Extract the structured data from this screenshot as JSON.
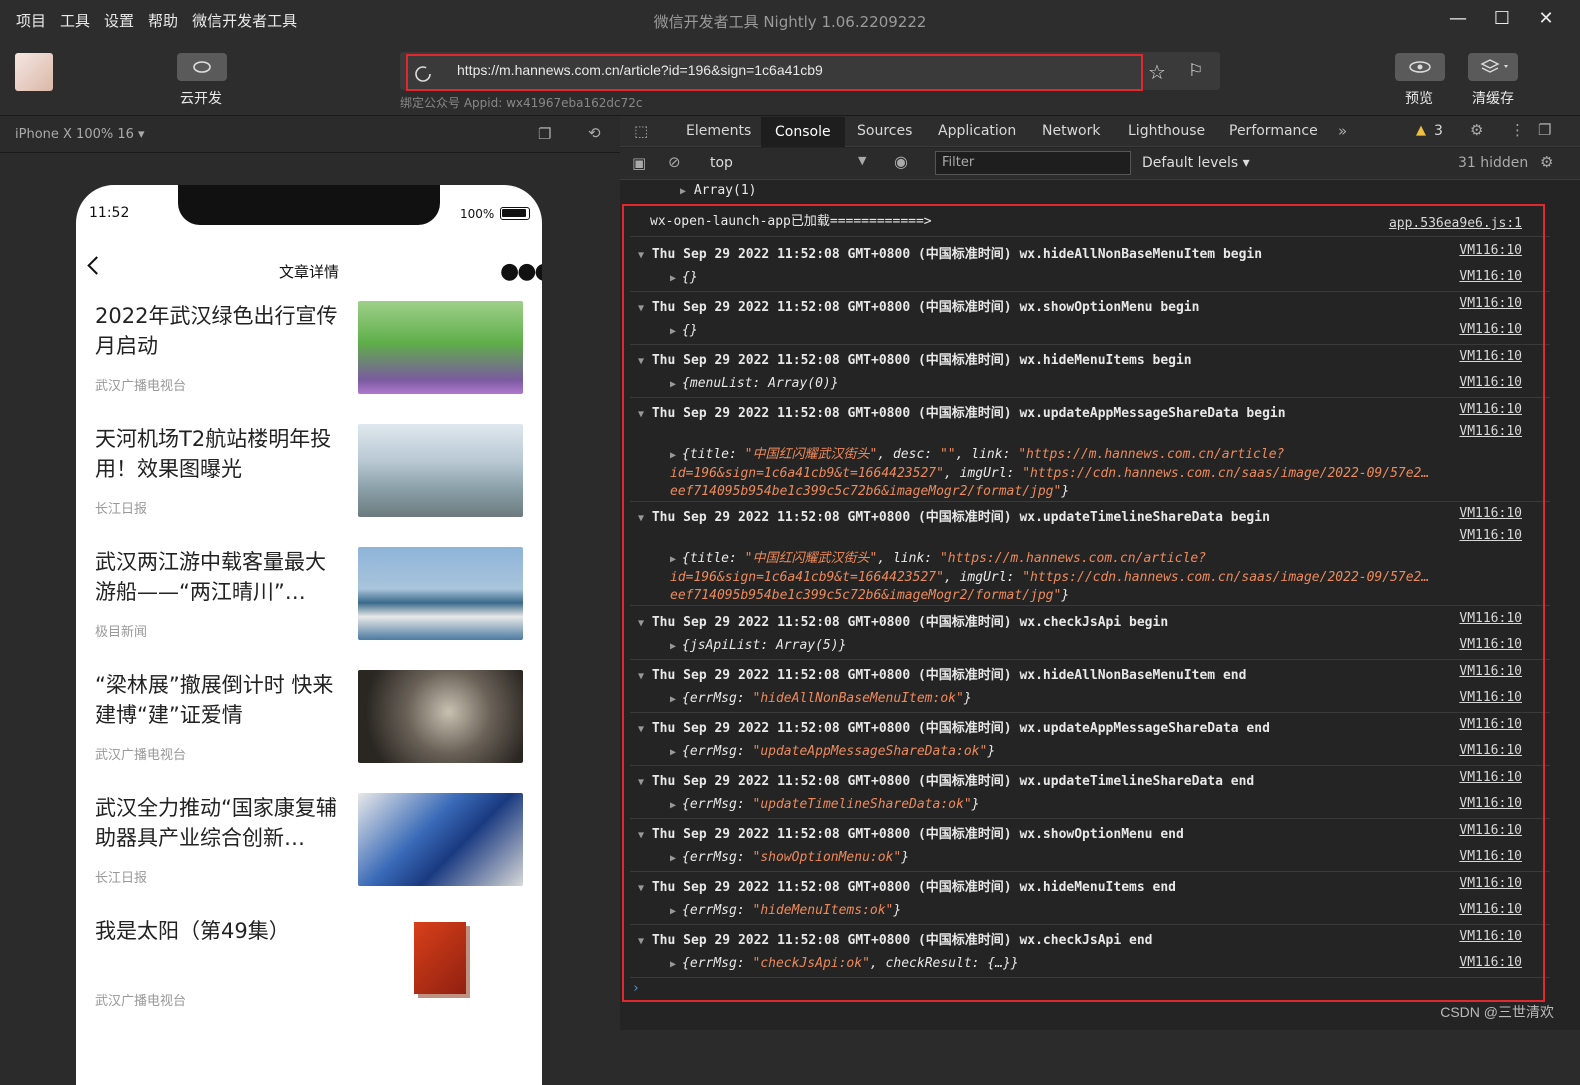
{
  "menu": [
    "项目",
    "工具",
    "设置",
    "帮助",
    "微信开发者工具"
  ],
  "window_title": "微信开发者工具 Nightly 1.06.2209222",
  "toolbar": {
    "cloud_label": "云开发",
    "url": "https://m.hannews.com.cn/article?id=196&sign=1c6a41cb9",
    "appid": "绑定公众号 Appid: wx41967eba162dc72c",
    "preview_label": "预览",
    "clearcache_label": "清缓存"
  },
  "device": "iPhone X 100% 16 ▾",
  "phone": {
    "time": "11:52",
    "battery": "100%",
    "nav_title": "文章详情",
    "news": [
      {
        "title": "2022年武汉绿色出行宣传月启动",
        "source": "武汉广播电视台"
      },
      {
        "title": "天河机场T2航站楼明年投用！效果图曝光",
        "source": "长江日报"
      },
      {
        "title": "武汉两江游中载客量最大游船——“两江晴川”…",
        "source": "极目新闻"
      },
      {
        "title": "“梁林展”撤展倒计时 快来建博“建”证爱情",
        "source": "武汉广播电视台"
      },
      {
        "title": "武汉全力推动“国家康复辅助器具产业综合创新…",
        "source": "长江日报"
      },
      {
        "title": "我是太阳（第49集）",
        "source": "武汉广播电视台"
      }
    ]
  },
  "devtools": {
    "tabs": [
      "Elements",
      "Console",
      "Sources",
      "Application",
      "Network",
      "Lighthouse",
      "Performance"
    ],
    "warnings": "3",
    "context": "top",
    "filter_placeholder": "Filter",
    "levels": "Default levels ▾",
    "hidden": "31 hidden"
  },
  "console": {
    "prev": "Array(1)",
    "first": {
      "text": "wx-open-launch-app已加载============>",
      "src": "app.536ea9e6.js:1"
    },
    "src": "VM116:10",
    "entries": [
      {
        "h": "Thu Sep 29 2022 11:52:08 GMT+0800 (中国标准时间) wx.hideAllNonBaseMenuItem begin",
        "b": "{}"
      },
      {
        "h": "Thu Sep 29 2022 11:52:08 GMT+0800 (中国标准时间) wx.showOptionMenu begin",
        "b": "{}"
      },
      {
        "h": "Thu Sep 29 2022 11:52:08 GMT+0800 (中国标准时间) wx.hideMenuItems begin",
        "b": "{menuList: Array(0)}"
      },
      {
        "h": "Thu Sep 29 2022 11:52:08 GMT+0800 (中国标准时间) wx.updateAppMessageShareData begin",
        "b": "{title: \"中国红闪耀武汉街头\", desc: \"\", link: \"https://m.hannews.com.cn/article?id=196&sign=1c6a41cb9&t=1664423527\", imgUrl: \"https://cdn.hannews.com.cn/saas/image/2022-09/57e2…eef714095b954be1c399c5c72b6&imageMogr2/format/jpg\"}"
      },
      {
        "h": "Thu Sep 29 2022 11:52:08 GMT+0800 (中国标准时间) wx.updateTimelineShareData begin",
        "b": "{title: \"中国红闪耀武汉街头\", link: \"https://m.hannews.com.cn/article?id=196&sign=1c6a41cb9&t=1664423527\", imgUrl: \"https://cdn.hannews.com.cn/saas/image/2022-09/57e2…eef714095b954be1c399c5c72b6&imageMogr2/format/jpg\"}"
      },
      {
        "h": "Thu Sep 29 2022 11:52:08 GMT+0800 (中国标准时间) wx.checkJsApi begin",
        "b": "{jsApiList: Array(5)}"
      },
      {
        "h": "Thu Sep 29 2022 11:52:08 GMT+0800 (中国标准时间) wx.hideAllNonBaseMenuItem end",
        "b": "{errMsg: \"hideAllNonBaseMenuItem:ok\"}"
      },
      {
        "h": "Thu Sep 29 2022 11:52:08 GMT+0800 (中国标准时间) wx.updateAppMessageShareData end",
        "b": "{errMsg: \"updateAppMessageShareData:ok\"}"
      },
      {
        "h": "Thu Sep 29 2022 11:52:08 GMT+0800 (中国标准时间) wx.updateTimelineShareData end",
        "b": "{errMsg: \"updateTimelineShareData:ok\"}"
      },
      {
        "h": "Thu Sep 29 2022 11:52:08 GMT+0800 (中国标准时间) wx.showOptionMenu end",
        "b": "{errMsg: \"showOptionMenu:ok\"}"
      },
      {
        "h": "Thu Sep 29 2022 11:52:08 GMT+0800 (中国标准时间) wx.hideMenuItems end",
        "b": "{errMsg: \"hideMenuItems:ok\"}"
      },
      {
        "h": "Thu Sep 29 2022 11:52:08 GMT+0800 (中国标准时间) wx.checkJsApi end",
        "b": "{errMsg: \"checkJsApi:ok\", checkResult: {…}}"
      }
    ]
  },
  "watermark": "CSDN @三世清欢",
  "colors": {
    "highlight": "#e0282e",
    "string": "#ee8a5a",
    "bg": "#242424"
  }
}
